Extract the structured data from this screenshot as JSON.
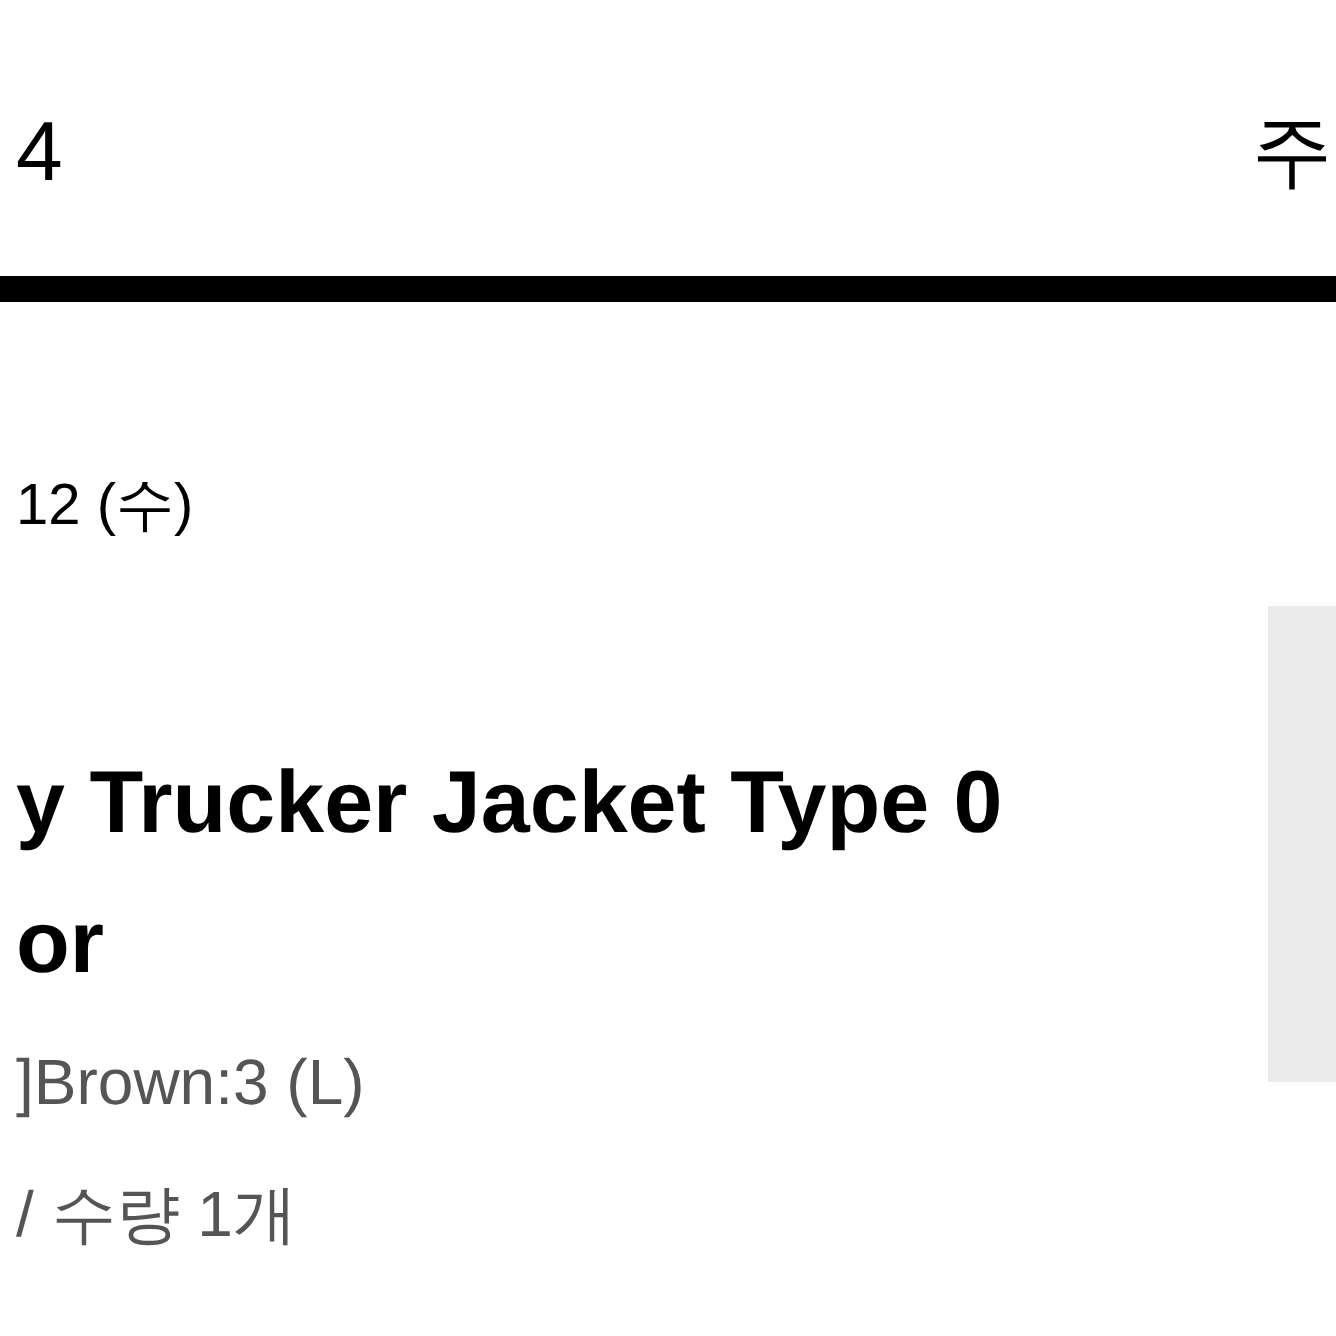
{
  "header": {
    "title": "4",
    "right_label": "주"
  },
  "order": {
    "date": "12 (수)",
    "product_name_lines": [
      "y Trucker Jacket Type 0",
      "or"
    ],
    "option": "]Brown:3 (L)",
    "quantity": "/ 수량 1개"
  }
}
